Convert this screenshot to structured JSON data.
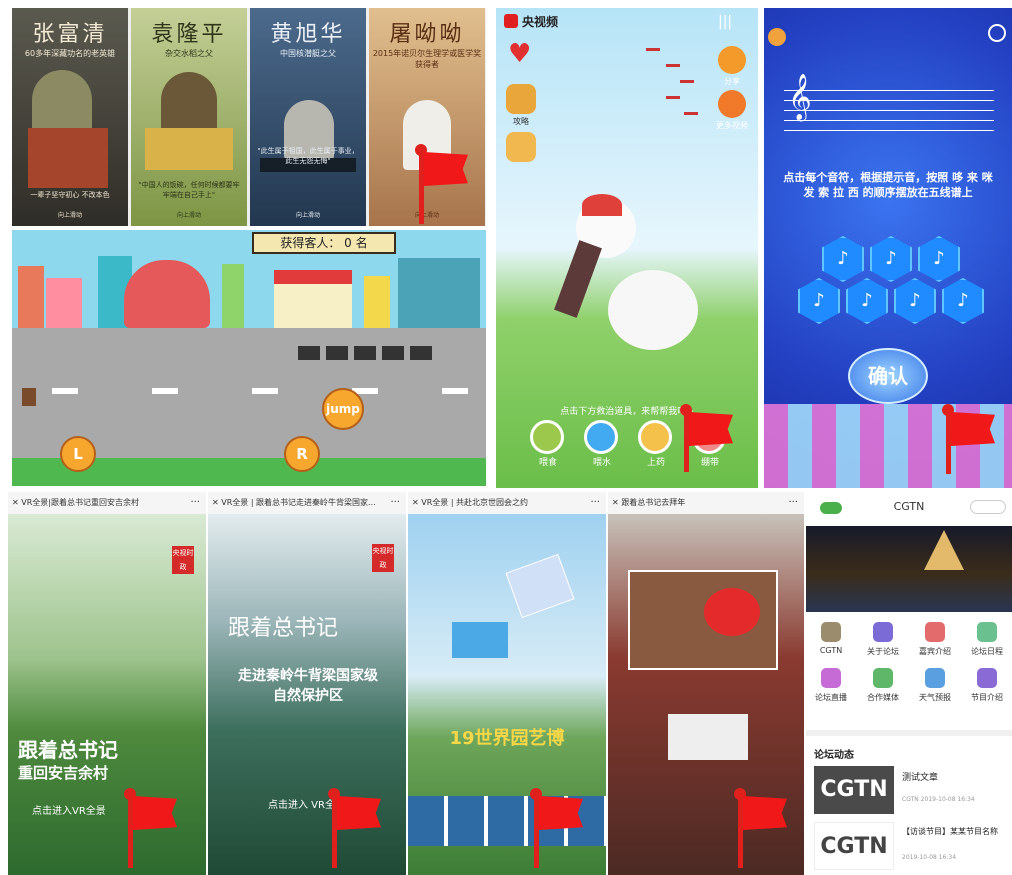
{
  "portraits": [
    {
      "name": "张富清",
      "subtitle": "60多年深藏功名的老英雄",
      "quote": "一辈子坚守初心 不改本色",
      "button": "向上滑动",
      "bg": "#3b3a33",
      "fg": "#f3ead6"
    },
    {
      "name": "袁隆平",
      "subtitle": "杂交水稻之父",
      "quote": "\"中国人的饭碗，任何时候都要牢牢端在自己手上\"",
      "button": "向上滑动",
      "bg": "#9eb06a",
      "fg": "#2d3418"
    },
    {
      "name": "黄旭华",
      "subtitle": "中国核潜艇之父",
      "quote": "\"此生属于祖国，此生属于事业，此生无怨无悔\"",
      "button": "向上滑动",
      "bg": "#2f4966",
      "fg": "#eaf0f6"
    },
    {
      "name": "屠呦呦",
      "subtitle": "2015年诺贝尔生理学或医学奖获得者",
      "quote": "",
      "button": "向上滑动",
      "bg": "#cf9d6c",
      "fg": "#5a2e12"
    }
  ],
  "game": {
    "score_label": "获得客人：  0  名",
    "jump_label": "jump",
    "left_label": "L",
    "right_label": "R"
  },
  "crane": {
    "app_name": "央视频",
    "share_label": "分享",
    "more_label": "更多视频",
    "wiki_label": "攻略",
    "hint": "点击下方救治道具，来帮帮我吧~",
    "tools": [
      "喂食",
      "喂水",
      "上药",
      "绷带"
    ]
  },
  "music": {
    "instruction": "点击每个音符，根据提示音，按照 哆 来 咪 发 索 拉 西 的顺序摆放在五线谱上",
    "confirm": "确认",
    "note_glyph": "♪"
  },
  "vr": [
    {
      "title": "VR全景|跟着总书记重回安吉余村",
      "cover_title": "跟着总书记",
      "cover_sub": "重回安吉余村",
      "enter": "点击进入VR全景",
      "badge": "央视时政",
      "more": "···",
      "close": "✕"
    },
    {
      "title": "VR全景 | 跟着总书记走进秦岭牛背梁国家...",
      "cover_title": "跟着总书记",
      "cover_sub": "走进秦岭牛背梁国家级自然保护区",
      "enter": "点击进入 VR全景",
      "badge": "央视时政",
      "more": "···",
      "close": "✕"
    },
    {
      "title": "VR全景 | 共赴北京世园会之约",
      "cover_title": "19世界园艺博",
      "cover_sub": "",
      "enter": "",
      "badge": "",
      "more": "···",
      "close": "✕"
    },
    {
      "title": "跟着总书记去拜年",
      "cover_title": "",
      "cover_sub": "",
      "enter": "",
      "badge": "",
      "more": "···",
      "close": "✕"
    }
  ],
  "cgtn": {
    "header": "CGTN",
    "menu": [
      {
        "label": "CGTN",
        "color": "#9b8c6e"
      },
      {
        "label": "关于论坛",
        "color": "#7b6bd6"
      },
      {
        "label": "嘉宾介绍",
        "color": "#e36b6b"
      },
      {
        "label": "论坛日程",
        "color": "#6ac08f"
      },
      {
        "label": "论坛直播",
        "color": "#c66bd6"
      },
      {
        "label": "合作媒体",
        "color": "#5fb86a"
      },
      {
        "label": "天气预报",
        "color": "#5a9fe0"
      },
      {
        "label": "节目介绍",
        "color": "#8a6bd6"
      }
    ],
    "section": "论坛动态",
    "news": [
      {
        "thumb": "CGTN",
        "title": "测试文章",
        "meta": "CGTN  2019-10-08 16:34"
      },
      {
        "thumb": "CGTN",
        "title": "【访谈节目】某某节目名称",
        "meta": "2019-10-08 16:34"
      }
    ]
  }
}
